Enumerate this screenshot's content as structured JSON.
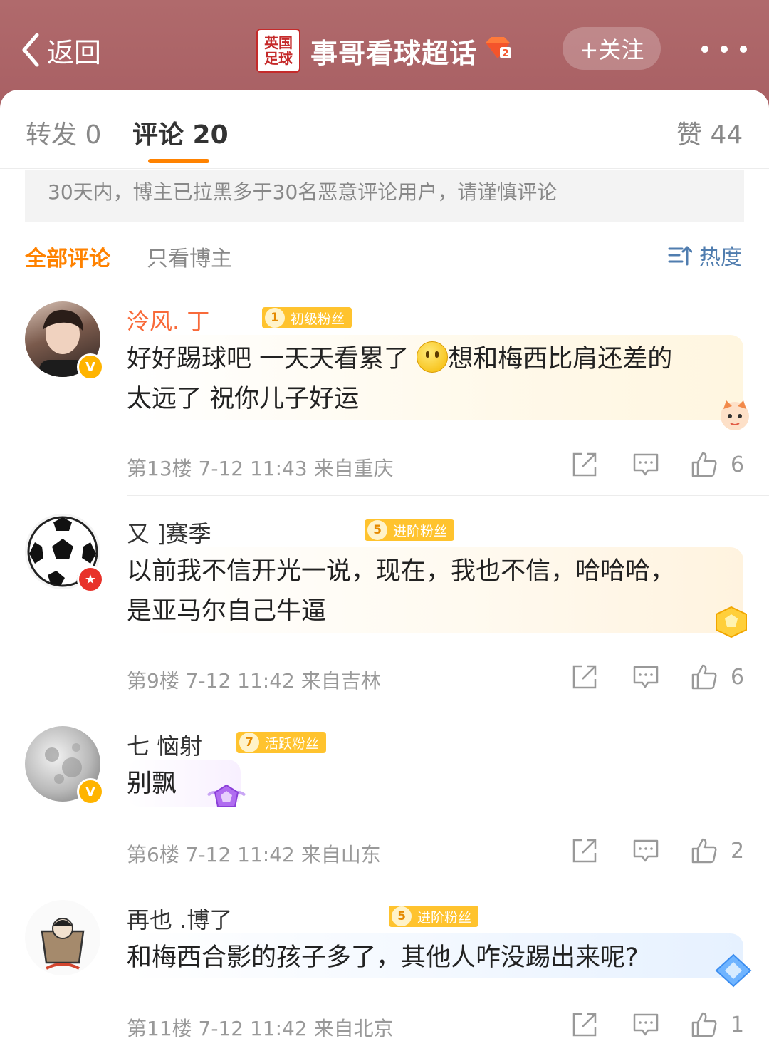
{
  "header": {
    "back_label": "返回",
    "logo_text": "英国\n足球",
    "title": "事哥看球超话",
    "level": "2",
    "follow_label": "+关注"
  },
  "tabs": {
    "repost": "转发 0",
    "comments": "评论 20",
    "likes": "赞 44"
  },
  "notice": "30天内，博主已拉黑多于30名恶意评论用户，请谨慎评论",
  "filters": {
    "all": "全部评论",
    "host_only": "只看博主",
    "sort": "热度"
  },
  "comments": [
    {
      "user": "泠风.        丁",
      "fan_level": "1",
      "fan_label": "初级粉丝",
      "text_line1": "好好踢球吧 一天天看累了",
      "text_line1b": "想和梅西比肩还差的",
      "text_line2": "太远了 祝你儿子好运",
      "meta": "第13楼 7-12 11:43 来自重庆",
      "likes": "6"
    },
    {
      "user": "又                    ]赛季",
      "fan_level": "5",
      "fan_label": "进阶粉丝",
      "text_line1": "以前我不信开光一说，现在，我也不信，哈哈哈，",
      "text_line2": "是亚马尔自己牛逼",
      "meta": "第9楼 7-12 11:42 来自吉林",
      "likes": "6"
    },
    {
      "user": "七     恼射",
      "fan_level": "7",
      "fan_label": "活跃粉丝",
      "text_line1": "别飘",
      "meta": "第6楼 7-12 11:42 来自山东",
      "likes": "2"
    },
    {
      "user": "再也                    .博了",
      "fan_level": "5",
      "fan_label": "进阶粉丝",
      "text_line1": "和梅西合影的孩子多了，其他人咋没踢出来呢?",
      "meta": "第11楼 7-12 11:42 来自北京",
      "likes": "1"
    }
  ],
  "colors": {
    "header_bg": "#a85f63",
    "accent": "#ff8200",
    "link_blue": "#507daf",
    "fan_badge": "#ffc32e"
  }
}
